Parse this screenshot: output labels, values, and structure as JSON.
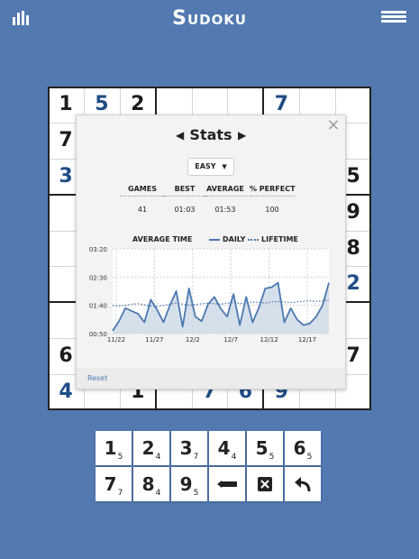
{
  "app": {
    "title": "Sudoku"
  },
  "board": {
    "cells": [
      {
        "r": 0,
        "c": 0,
        "v": "1",
        "user": false
      },
      {
        "r": 0,
        "c": 1,
        "v": "5",
        "user": true
      },
      {
        "r": 0,
        "c": 2,
        "v": "2",
        "user": false
      },
      {
        "r": 0,
        "c": 6,
        "v": "7",
        "user": true
      },
      {
        "r": 1,
        "c": 0,
        "v": "7",
        "user": false
      },
      {
        "r": 2,
        "c": 0,
        "v": "3",
        "user": true
      },
      {
        "r": 2,
        "c": 8,
        "v": "5",
        "user": false
      },
      {
        "r": 3,
        "c": 8,
        "v": "9",
        "user": false
      },
      {
        "r": 4,
        "c": 8,
        "v": "8",
        "user": false
      },
      {
        "r": 5,
        "c": 8,
        "v": "2",
        "user": true
      },
      {
        "r": 7,
        "c": 0,
        "v": "6",
        "user": false
      },
      {
        "r": 7,
        "c": 8,
        "v": "7",
        "user": false
      },
      {
        "r": 8,
        "c": 0,
        "v": "4",
        "user": true
      },
      {
        "r": 8,
        "c": 2,
        "v": "1",
        "user": false
      },
      {
        "r": 8,
        "c": 4,
        "v": "7",
        "user": true
      },
      {
        "r": 8,
        "c": 5,
        "v": "6",
        "user": true
      },
      {
        "r": 8,
        "c": 6,
        "v": "9",
        "user": true
      }
    ]
  },
  "stats_popup": {
    "title": "Stats",
    "close": "×",
    "prev_arrow": "◀",
    "next_arrow": "▶",
    "difficulty": "EASY",
    "difficulty_caret": "▼",
    "columns": [
      {
        "label": "GAMES",
        "value": "41"
      },
      {
        "label": "BEST",
        "value": "01:03"
      },
      {
        "label": "AVERAGE",
        "value": "01:53"
      },
      {
        "label": "% PERFECT",
        "value": "100"
      }
    ],
    "chart_title": "AVERAGE TIME",
    "legend_daily": "DAILY",
    "legend_lifetime": "LIFETIME",
    "reset_label": "Reset"
  },
  "chart_data": {
    "type": "line",
    "x": [
      "11/22",
      "11/27",
      "12/2",
      "12/7",
      "12/12",
      "12/17"
    ],
    "x_ticks": [
      "11/22",
      "11/27",
      "12/2",
      "12/7",
      "12/12",
      "12/17"
    ],
    "y_ticks": [
      "00:50",
      "01:40",
      "02:30",
      "03:20"
    ],
    "ylim": [
      50,
      200
    ],
    "series": [
      {
        "name": "DAILY",
        "values": [
          55,
          72,
          95,
          90,
          85,
          70,
          110,
          92,
          70,
          100,
          125,
          62,
          130,
          80,
          72,
          102,
          115,
          94,
          80,
          120,
          65,
          115,
          70,
          96,
          130,
          132,
          140,
          70,
          95,
          75,
          65,
          68,
          80,
          100,
          140
        ]
      },
      {
        "name": "LIFETIME",
        "values": [
          100,
          99,
          100,
          102,
          103,
          101,
          99,
          98,
          100,
          102,
          104,
          102,
          100,
          101,
          103,
          104,
          103,
          102,
          104,
          105,
          103,
          104,
          106,
          105,
          104,
          106,
          107,
          106,
          105,
          106,
          107,
          108,
          107,
          108,
          110
        ]
      }
    ],
    "colors": {
      "daily": "#4a78b0",
      "lifetime": "#4a78b0",
      "fill": "#cfdbe8"
    }
  },
  "keypad": {
    "keys": [
      {
        "num": "1",
        "count": "5"
      },
      {
        "num": "2",
        "count": "4"
      },
      {
        "num": "3",
        "count": "7"
      },
      {
        "num": "4",
        "count": "4"
      },
      {
        "num": "5",
        "count": "5"
      },
      {
        "num": "6",
        "count": "5"
      },
      {
        "num": "7",
        "count": "7"
      },
      {
        "num": "8",
        "count": "4"
      },
      {
        "num": "9",
        "count": "5"
      }
    ],
    "pencil": "pencil-icon",
    "erase": "erase-icon",
    "undo": "undo-icon"
  }
}
